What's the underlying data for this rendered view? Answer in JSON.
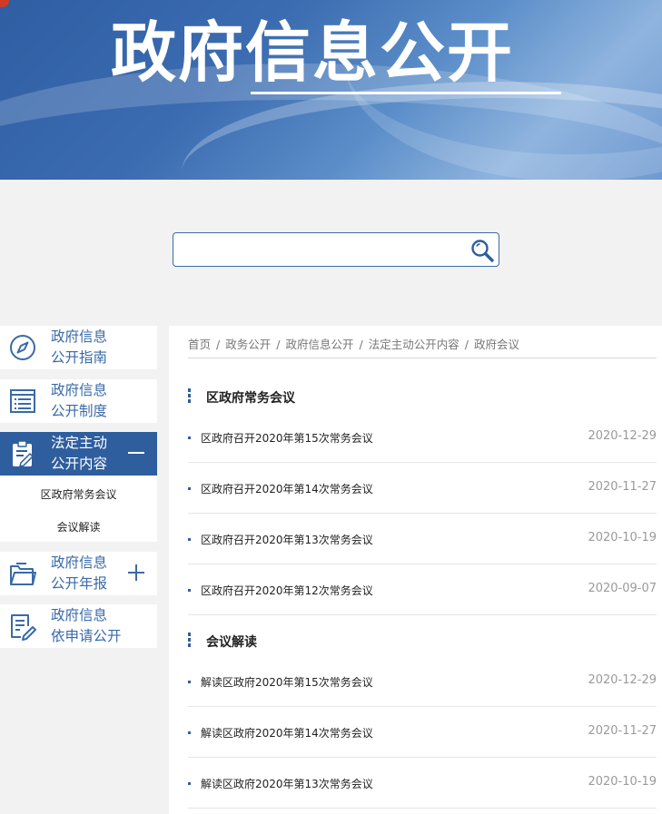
{
  "banner": {
    "title": "政府信息公开"
  },
  "search": {
    "placeholder": ""
  },
  "sidebar": {
    "items": [
      {
        "line1": "政府信息",
        "line2": "公开指南"
      },
      {
        "line1": "政府信息",
        "line2": "公开制度"
      },
      {
        "line1": "法定主动",
        "line2": "公开内容",
        "toggle": "−",
        "active": true
      },
      {
        "line1": "政府信息",
        "line2": "公开年报",
        "toggle": "+"
      },
      {
        "line1": "政府信息",
        "line2": "依申请公开"
      }
    ],
    "submenu": [
      "区政府常务会议",
      "会议解读"
    ]
  },
  "breadcrumb": [
    "首页",
    "政务公开",
    "政府信息公开",
    "法定主动公开内容",
    "政府会议"
  ],
  "sections": [
    {
      "title": "区政府常务会议",
      "rows": [
        {
          "title": "区政府召开2020年第15次常务会议",
          "date": "2020-12-29"
        },
        {
          "title": "区政府召开2020年第14次常务会议",
          "date": "2020-11-27"
        },
        {
          "title": "区政府召开2020年第13次常务会议",
          "date": "2020-10-19"
        },
        {
          "title": "区政府召开2020年第12次常务会议",
          "date": "2020-09-07"
        }
      ]
    },
    {
      "title": "会议解读",
      "rows": [
        {
          "title": "解读区政府2020年第15次常务会议",
          "date": "2020-12-29"
        },
        {
          "title": "解读区政府2020年第14次常务会议",
          "date": "2020-11-27"
        },
        {
          "title": "解读区政府2020年第13次常务会议",
          "date": "2020-10-19"
        }
      ]
    }
  ],
  "colors": {
    "accent": "#2f5e9e",
    "text": "#222222",
    "muted": "#9a9a9a",
    "background": "#f2f2f2"
  }
}
